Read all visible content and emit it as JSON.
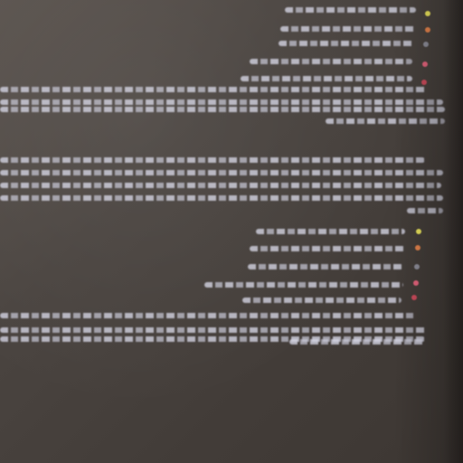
{
  "scene": {
    "description_kind": "photo",
    "background_color": "#4b4540",
    "text_color": "#d2d2e1"
  },
  "bullet_colors": {
    "yellow": "#e6df5a",
    "orange": "#e0804a",
    "gray": "#8a8a95",
    "pink": "#e0627a",
    "red": "#c84a5a"
  }
}
